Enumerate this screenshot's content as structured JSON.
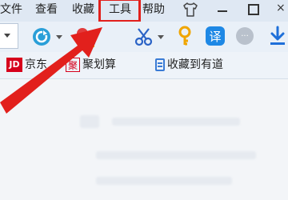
{
  "menubar": {
    "items": [
      {
        "label": "文件"
      },
      {
        "label": "查看"
      },
      {
        "label": "收藏"
      },
      {
        "label": "工具"
      },
      {
        "label": "帮助"
      }
    ],
    "close_glyph": "×"
  },
  "toolbar": {
    "icons": [
      "back-forward-icon",
      "snapshot-icon",
      "screenshot-icon",
      "scissors-icon",
      "key-icon",
      "translate-icon",
      "more-icon",
      "download-icon"
    ],
    "translate_label": "译",
    "more_label": "···"
  },
  "bookmarks": [
    {
      "logo": "JD",
      "label": "京东"
    },
    {
      "logo": "聚",
      "label": "聚划算"
    },
    {
      "label": "收藏到有道"
    }
  ],
  "colors": {
    "highlight": "#e2201c",
    "arrow": "#e2201c",
    "jd_red": "#d6001c",
    "accent_blue": "#1e88e5"
  }
}
